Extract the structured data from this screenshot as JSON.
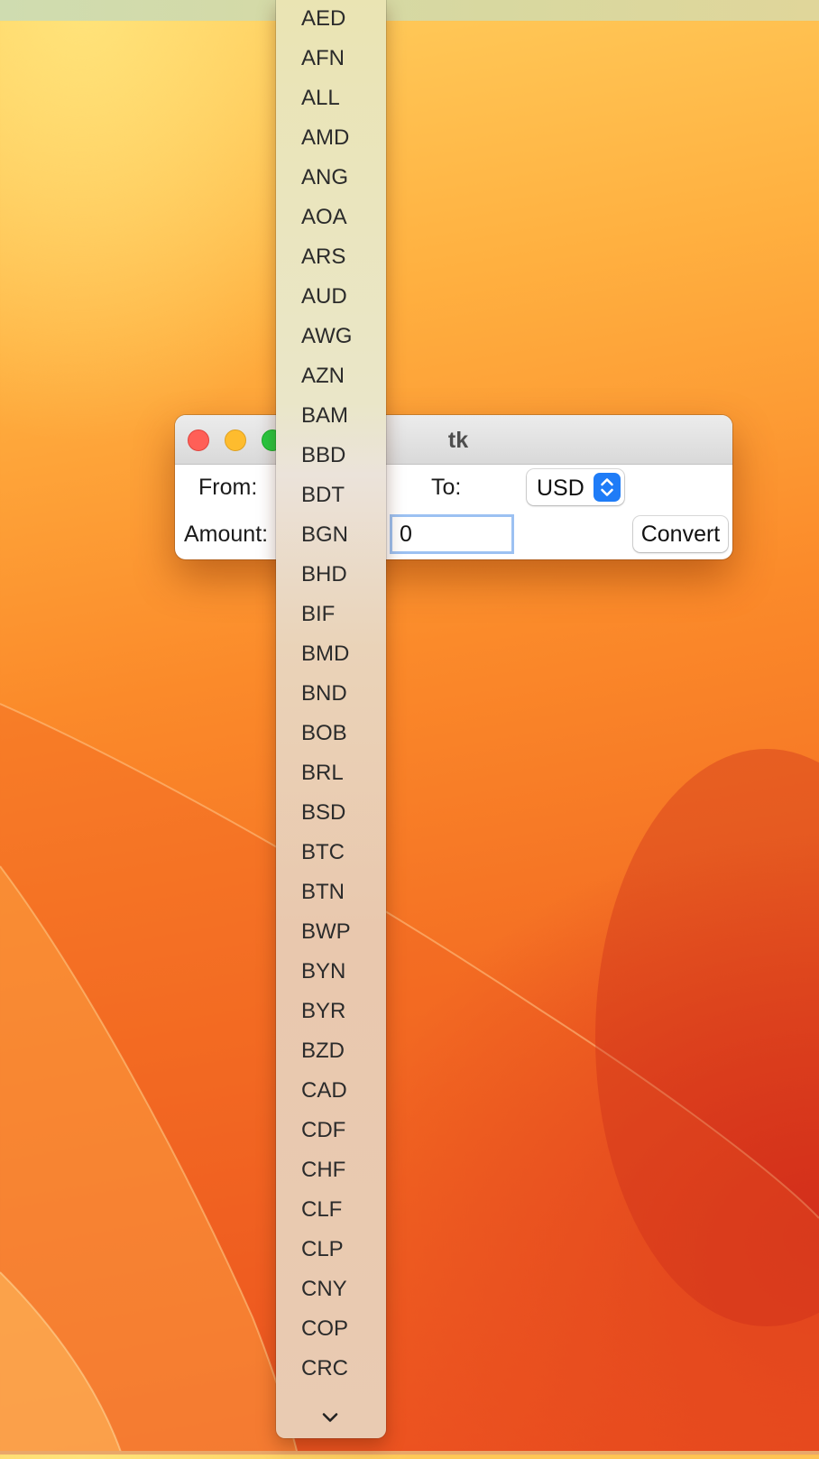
{
  "window": {
    "title": "tk",
    "from_label": "From:",
    "to_label": "To:",
    "to_selected": "USD",
    "amount_label": "Amount:",
    "amount_value": "0",
    "convert_label": "Convert"
  },
  "dropdown": {
    "items": [
      "AED",
      "AFN",
      "ALL",
      "AMD",
      "ANG",
      "AOA",
      "ARS",
      "AUD",
      "AWG",
      "AZN",
      "BAM",
      "BBD",
      "BDT",
      "BGN",
      "BHD",
      "BIF",
      "BMD",
      "BND",
      "BOB",
      "BRL",
      "BSD",
      "BTC",
      "BTN",
      "BWP",
      "BYN",
      "BYR",
      "BZD",
      "CAD",
      "CDF",
      "CHF",
      "CLF",
      "CLP",
      "CNY",
      "COP",
      "CRC"
    ],
    "more_icon": "chevron-down-icon"
  },
  "colors": {
    "accent": "#1f7cf7",
    "close": "#ff5f57",
    "minimize": "#febc2e",
    "maximize": "#28c840"
  }
}
